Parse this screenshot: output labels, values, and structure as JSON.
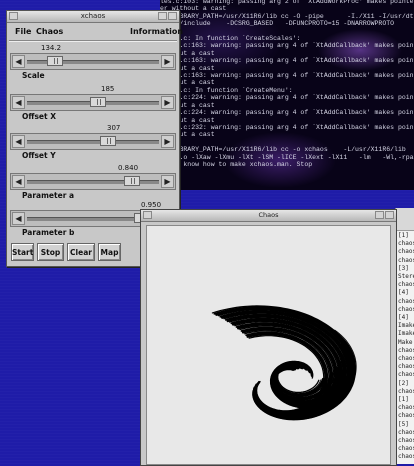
{
  "terminal": {
    "lines": [
      "les.c:103: warning: passing arg 2 of `XtAddWorkProc' makes pointer",
      "er without a cast",
      "LD_LIBRARY_PATH=/usr/X11R6/lib cc -O -pipe      -I./X11 -I/usr/dt/share/inc",
      "X11R6/include    -DCSRG_BASED   -DFUNCPROTO=15 -DNARROWPROTO",
      "",
      "xtles.c: In function `CreateScales':",
      "xtles.c:163: warning: passing arg 4 of `XtAddCallback' makes pointer",
      "without a cast",
      "xtles.c:163: warning: passing arg 4 of `XtAddCallback' makes pointer",
      "without a cast",
      "xtles.c:163: warning: passing arg 4 of `XtAddCallback' makes pointer",
      "without a cast",
      "xtles.c: In function `CreateMenu':",
      "xtles.c:224: warning: passing arg 4 of `XtAddCallback' makes pointer",
      "without a cast",
      "xtles.c:224: warning: passing arg 4 of `XtAddCallback' makes pointer",
      "without a cast",
      "xtles.c:232: warning: passing arg 4 of `XtAddCallback' makes pointer",
      "without a cast",
      "chaos",
      "LD_LIBRARY_PATH=/usr/X11R6/lib cc -o xchaos    -L/usr/X11R6/lib  -Wchaos.o",
      "chaos.o -lXaw -lXmu -lXt -lSM -lICE -lXext -lX11   -lm   -Wl,-rpath,/usr/X11R6/lib",
      "don't know how to make xchaos.man. Stop"
    ]
  },
  "xterm_right": {
    "lines": [
      "[1]",
      "chaos",
      "chaos",
      "chaos",
      "[3]",
      "Stere",
      "chaos",
      "[4]",
      "chaos",
      "chaos",
      "[4]",
      "Imake",
      "Imake",
      "Make",
      "chaos",
      "chaos",
      "chaos",
      "chaos",
      "[2]",
      "chaos",
      "[1]",
      "chaos",
      "chaos",
      "[5]",
      "chaos",
      "chaos",
      "chaos",
      "chaos"
    ]
  },
  "xchaos_window": {
    "title": "xchaos",
    "menu": {
      "file": "File",
      "chaos": "Chaos",
      "information": "Information"
    },
    "sliders": [
      {
        "label": "Scale",
        "value": "134.2",
        "level": 0.17
      },
      {
        "label": "Offset X",
        "value": "185",
        "level": 0.53
      },
      {
        "label": "Offset Y",
        "value": "307",
        "level": 0.62
      },
      {
        "label": "Parameter a",
        "value": "0.840",
        "level": 0.82
      },
      {
        "label": "Parameter b",
        "value": "0.950",
        "level": 0.91
      }
    ],
    "buttons": {
      "start": "Start",
      "stop": "Stop",
      "clear": "Clear",
      "map": "Map"
    }
  },
  "chaos_window": {
    "title": "Chaos"
  },
  "colors": {
    "desktop": "#1f1ca8",
    "panel": "#c8c8c8",
    "terminal_bg": "#080318",
    "attractor": "#000000",
    "canvas": "#e8e8e8"
  }
}
